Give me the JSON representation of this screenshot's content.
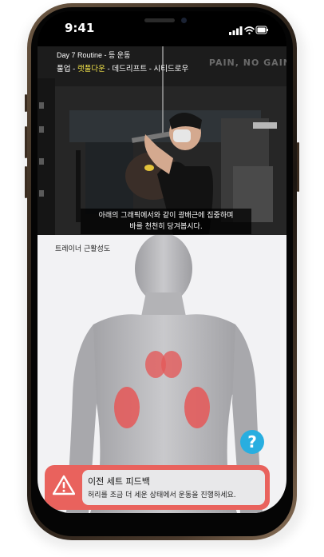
{
  "status_bar": {
    "time": "9:41"
  },
  "routine": {
    "title": "Day 7 Routine - 등 운동",
    "exercises": [
      "풀업",
      "랫풀다운",
      "데드리프트",
      "시티드로우"
    ],
    "separator": " - ",
    "active_index": 1,
    "active_color": "#f0e14a"
  },
  "video": {
    "wall_text": "PAIN, NO GAIN",
    "subtitle_line1": "아래의 그래픽에서와 같이 광배근에 집중하며",
    "subtitle_line2": "바를 천천히 당겨봅시다."
  },
  "muscle_panel": {
    "label": "트레이너 근활성도",
    "highlight_color": "#e45a5a",
    "help_icon": "question-icon",
    "help_symbol": "?"
  },
  "feedback": {
    "title": "이전 세트 피드백",
    "message": "허리를 조금 더 세운 상태에서 운동을 진행하세요.",
    "icon": "warning-icon",
    "banner_color": "#e9625d"
  }
}
